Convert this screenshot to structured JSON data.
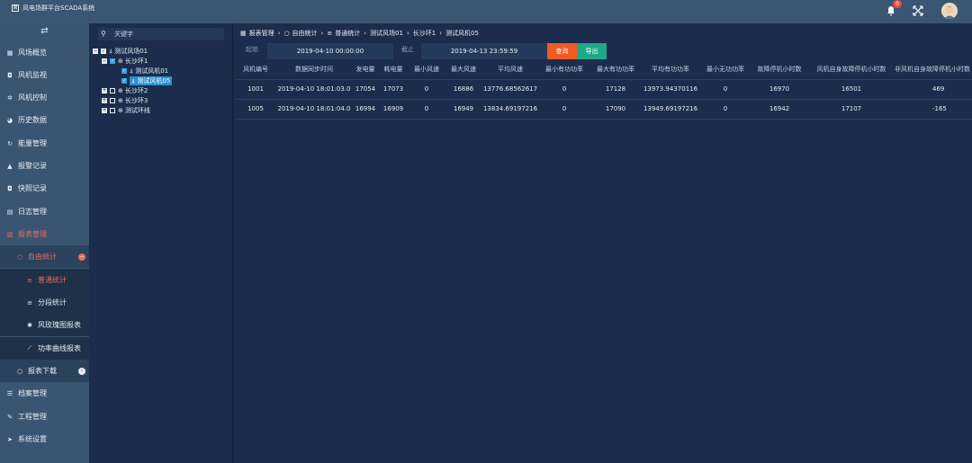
{
  "app": {
    "title": "风电场群平台SCADA系统",
    "logo_glyph": "⊠"
  },
  "header": {
    "notification_count": "0",
    "colors": {
      "badge": "#e84c3d",
      "topbar": "#3b5672"
    }
  },
  "sidebar": {
    "toggle_glyph": "⇄",
    "items": [
      {
        "label": "风场概览",
        "icon": "grid-icon",
        "glyph": "▦"
      },
      {
        "label": "风机监视",
        "icon": "camera-icon",
        "glyph": "◘"
      },
      {
        "label": "风机控制",
        "icon": "gear-icon",
        "glyph": "✲"
      },
      {
        "label": "历史数据",
        "icon": "pie-icon",
        "glyph": "◕"
      },
      {
        "label": "能量管理",
        "icon": "refresh-icon",
        "glyph": "↻"
      },
      {
        "label": "报警记录",
        "icon": "bell-icon",
        "glyph": "▲"
      },
      {
        "label": "快照记录",
        "icon": "camera-icon",
        "glyph": "◘"
      },
      {
        "label": "日志管理",
        "icon": "file-icon",
        "glyph": "▤"
      },
      {
        "label": "报表管理",
        "icon": "table-icon",
        "glyph": "▥"
      },
      {
        "label": "自由统计",
        "icon": "circle-icon",
        "glyph": "○"
      },
      {
        "label": "普通统计",
        "icon": "list-icon",
        "glyph": "≡"
      },
      {
        "label": "分段统计",
        "icon": "list-icon",
        "glyph": "≡"
      },
      {
        "label": "风玫瑰图报表",
        "icon": "star-icon",
        "glyph": "✱"
      },
      {
        "label": "功率曲线报表",
        "icon": "chart-line-icon",
        "glyph": "⟋"
      },
      {
        "label": "报表下载",
        "icon": "circle-icon",
        "glyph": "○"
      },
      {
        "label": "档案管理",
        "icon": "list-icon",
        "glyph": "☰"
      },
      {
        "label": "工程管理",
        "icon": "wrench-icon",
        "glyph": "✎"
      },
      {
        "label": "系统设置",
        "icon": "send-icon",
        "glyph": "➤"
      }
    ],
    "colors": {
      "active": "#e46e5d"
    }
  },
  "tree": {
    "search_placeholder": "关键字",
    "nodes": [
      {
        "label": "测试风场01",
        "level": 0,
        "expanded": true,
        "checked": true
      },
      {
        "label": "长沙环1",
        "level": 1,
        "expanded": true,
        "checked": true
      },
      {
        "label": "测试风机01",
        "level": 2,
        "checked": true
      },
      {
        "label": "测试风机05",
        "level": 2,
        "checked": true,
        "selected": true
      },
      {
        "label": "长沙环2",
        "level": 1,
        "expanded": false,
        "checked": false
      },
      {
        "label": "长沙环3",
        "level": 1,
        "expanded": false,
        "checked": false
      },
      {
        "label": "测试环线",
        "level": 1,
        "expanded": false,
        "checked": false
      }
    ]
  },
  "breadcrumb": {
    "items": [
      "报表管理",
      "自由统计",
      "普通统计",
      "测试风场01",
      "长沙环1",
      "测试风机05"
    ],
    "separator": "›"
  },
  "filter": {
    "start_label": "起始",
    "start_value": "2019-04-10 00:00:00",
    "end_label": "截止",
    "end_value": "2019-04-13 23:59:59",
    "query_label": "查询",
    "export_label": "导出",
    "colors": {
      "query": "#f25a22",
      "export": "#1fa888"
    }
  },
  "table": {
    "headers": [
      "风机编号",
      "数据同步时间",
      "发电量",
      "耗电量",
      "最小风速",
      "最大风速",
      "平均风速",
      "最小有功功率",
      "最大有功功率",
      "平均有功功率",
      "最小无功功率",
      "故障停机小时数",
      "风机自身故障停机小时数",
      "非风机自身故障停机小时数"
    ],
    "rows": [
      [
        "1001",
        "2019-04-10 18:01:03.0",
        "17054",
        "17073",
        "0",
        "16886",
        "13776.68562617",
        "0",
        "17128",
        "13973.94370116",
        "0",
        "16970",
        "16501",
        "469"
      ],
      [
        "1005",
        "2019-04-10 18:01:04.0",
        "16994",
        "16909",
        "0",
        "16949",
        "13834.69197216",
        "0",
        "17090",
        "13949.69197216",
        "0",
        "16942",
        "17107",
        "-165"
      ]
    ]
  }
}
